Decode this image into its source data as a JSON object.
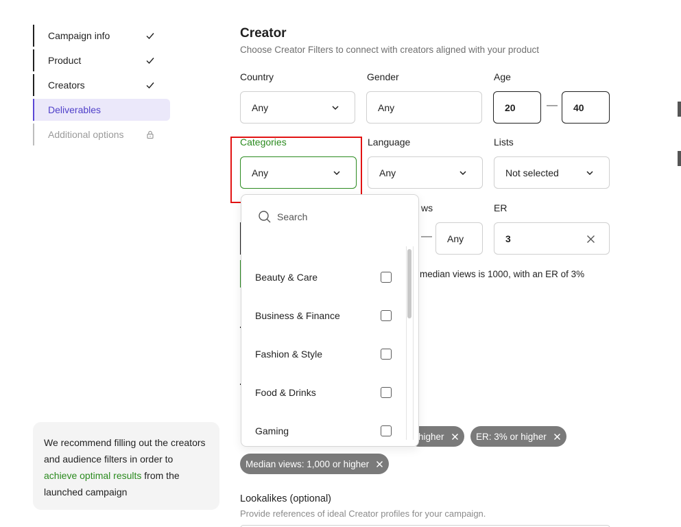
{
  "sidebar": {
    "steps": [
      {
        "label": "Campaign info",
        "state": "done"
      },
      {
        "label": "Product",
        "state": "done"
      },
      {
        "label": "Creators",
        "state": "done"
      },
      {
        "label": "Deliverables",
        "state": "active"
      },
      {
        "label": "Additional options",
        "state": "locked"
      }
    ],
    "tip": {
      "line1": "We recommend filling out the creators and audience filters in order to ",
      "link": "achieve optimal results",
      "line2": " from the launched campaign"
    }
  },
  "creator": {
    "title": "Creator",
    "subtitle": "Choose Creator Filters to connect with creators aligned with your product",
    "country": {
      "label": "Country",
      "value": "Any"
    },
    "gender": {
      "label": "Gender",
      "value": "Any"
    },
    "age": {
      "label": "Age",
      "min": "20",
      "max": "40",
      "separator": "—"
    },
    "categories": {
      "label": "Categories",
      "value": "Any"
    },
    "language": {
      "label": "Language",
      "value": "Any"
    },
    "lists": {
      "label": "Lists",
      "value": "Not selected"
    },
    "median_views": {
      "label_partial": "ws",
      "max": "Any",
      "separator": "—"
    },
    "er": {
      "label": "ER",
      "value": "3"
    },
    "info_partial": "median views is 1000, with an ER of 3%"
  },
  "chips": [
    {
      "label": "higher",
      "partial": true
    },
    {
      "label": "ER: 3% or higher"
    },
    {
      "label": "Median views: 1,000 or higher"
    }
  ],
  "lookalikes": {
    "title": "Lookalikes",
    "optional": " (optional)",
    "subtitle": "Provide references of ideal Creator profiles for your campaign."
  },
  "categories_dropdown": {
    "search_placeholder": "Search",
    "options": [
      {
        "label": "Beauty & Care",
        "checked": false
      },
      {
        "label": "Business & Finance",
        "checked": false
      },
      {
        "label": "Fashion & Style",
        "checked": false
      },
      {
        "label": "Food & Drinks",
        "checked": false
      },
      {
        "label": "Gaming",
        "checked": false
      }
    ]
  },
  "colors": {
    "accent": "#5b47d6",
    "success": "#2a8a1e",
    "highlight": "#e21212",
    "chip": "#7a7a7a"
  }
}
